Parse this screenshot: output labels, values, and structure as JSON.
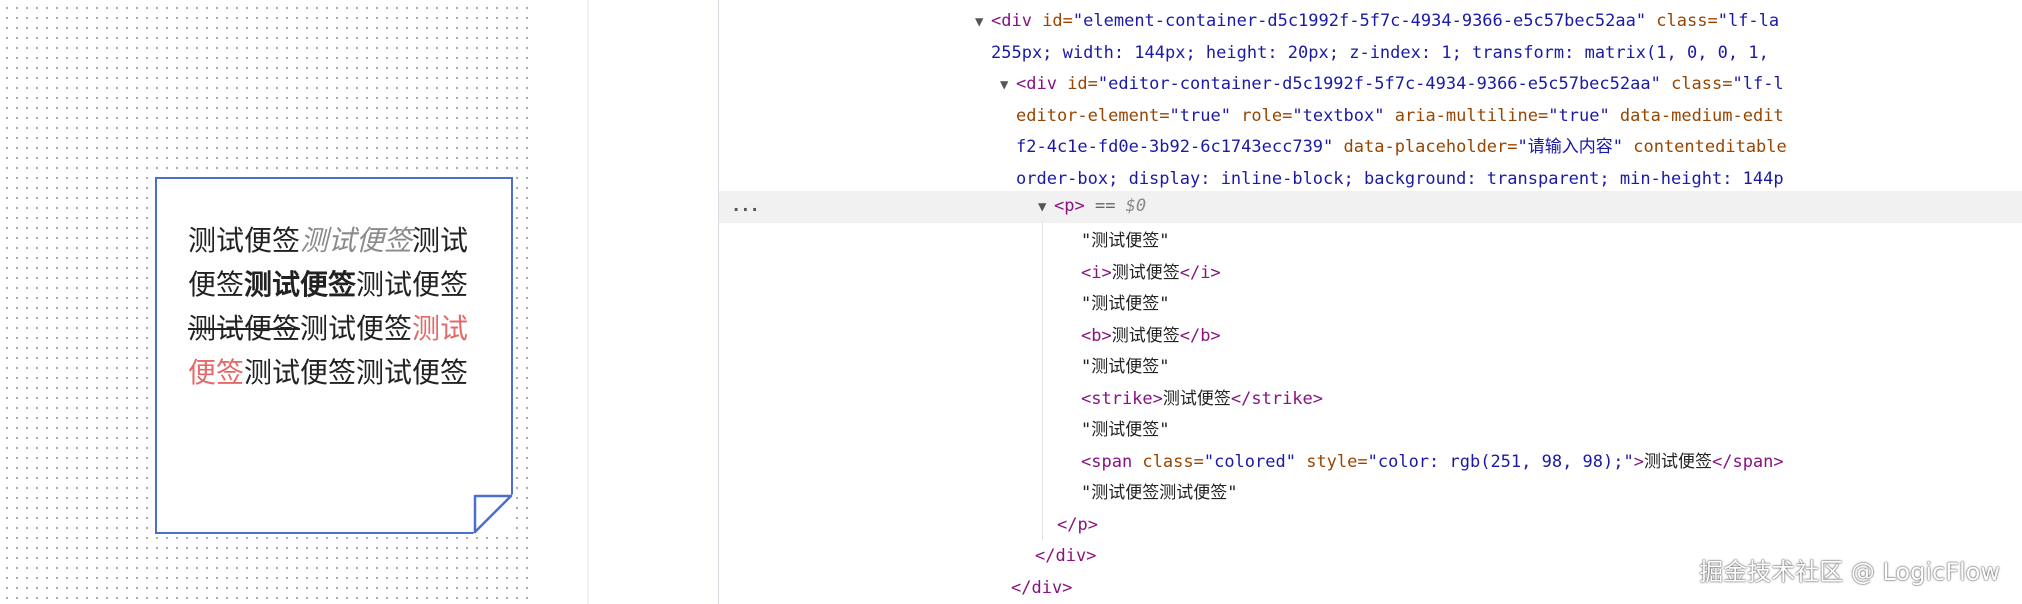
{
  "note": {
    "segments": {
      "plain1": "测试便签",
      "italic": "测试便签",
      "plain2": "测试便签",
      "bold": "测试便签",
      "plain3": "测试便签",
      "strike": "测试便签",
      "plain4": "测试便签",
      "colored": "测试便签",
      "plain5": "测试便签测试便签"
    },
    "border_color": "#4b6fd1",
    "colored_text_color": "#fb6262"
  },
  "devtools": {
    "rows": {
      "r0": {
        "tag_open": "<div ",
        "a1": "id=",
        "v1": "\"element-container-d5c1992f-5f7c-4934-9366-e5c57bec52aa\"",
        "a2": " class=",
        "v2": "\"lf-la"
      },
      "r1": {
        "text": "255px; width: 144px; height: 20px; z-index: 1; transform: matrix(1, 0, 0, 1,"
      },
      "r2": {
        "tag_open": "<div ",
        "a1": "id=",
        "v1": "\"editor-container-d5c1992f-5f7c-4934-9366-e5c57bec52aa\"",
        "a2": " class=",
        "v2": "\"lf-l"
      },
      "r3": {
        "a1": "editor-element=",
        "v1": "\"true\"",
        "a2": " role=",
        "v2": "\"textbox\"",
        "a3": " aria-multiline=",
        "v3": "\"true\"",
        "a4": " data-medium-edit"
      },
      "r4": {
        "v0": "f2-4c1e-fd0e-3b92-6c1743ecc739\"",
        "a1": " data-placeholder=",
        "v1": "\"请输入内容\"",
        "a2": " contenteditable"
      },
      "r5": {
        "text": "order-box; display: inline-block; background: transparent; min-height: 144p"
      },
      "r6": {
        "tag": "<p>",
        "eq": " == ",
        "ref": "$0",
        "dots": "..."
      },
      "r7": {
        "text": "\"测试便签\""
      },
      "r8": {
        "open": "<i>",
        "text": "测试便签",
        "close": "</i>"
      },
      "r9": {
        "text": "\"测试便签\""
      },
      "r10": {
        "open": "<b>",
        "text": "测试便签",
        "close": "</b>"
      },
      "r11": {
        "text": "\"测试便签\""
      },
      "r12": {
        "open": "<strike>",
        "text": "测试便签",
        "close": "</strike>"
      },
      "r13": {
        "text": "\"测试便签\""
      },
      "r14": {
        "open": "<span ",
        "a1": "class=",
        "v1": "\"colored\"",
        "a2": " style=",
        "v2": "\"color: rgb(251, 98, 98);\"",
        "gt": ">",
        "text": "测试便签",
        "close": "</span>"
      },
      "r15": {
        "text": "\"测试便签测试便签\""
      },
      "r16": {
        "close": "</p>"
      },
      "r17": {
        "close": "</div>"
      },
      "r18": {
        "close": "</div>"
      }
    }
  },
  "watermark": "掘金技术社区 @ LogicFlow"
}
